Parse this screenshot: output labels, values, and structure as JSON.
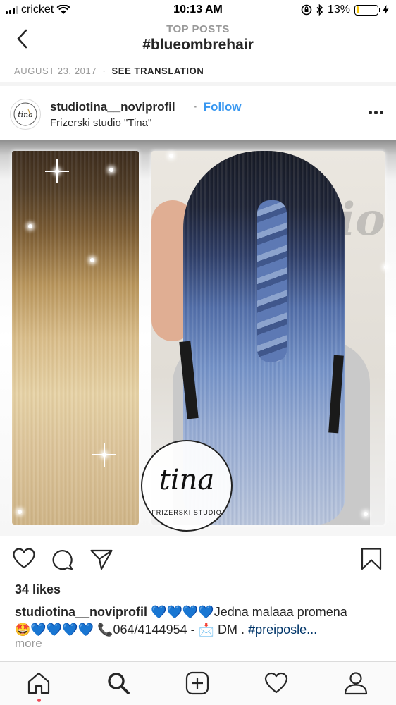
{
  "status_bar": {
    "carrier": "cricket",
    "time": "10:13 AM",
    "battery": "13%",
    "battery_level": 0.13
  },
  "header": {
    "subtitle": "TOP POSTS",
    "title": "#blueombrehair"
  },
  "post_meta": {
    "date": "AUGUST 23, 2017",
    "separator": "·",
    "translation_label": "SEE TRANSLATION"
  },
  "post": {
    "username": "studiotina__noviprofil",
    "follow_separator": "·",
    "follow_label": "Follow",
    "location": "Frizerski studio \"Tina\"",
    "image": {
      "logo_text": "tina",
      "logo_subtext": "FRIZERSKI STUDIO"
    },
    "likes": "34 likes",
    "caption": {
      "username": "studiotina__noviprofil",
      "hearts_1": "💙💙💙💙",
      "text_1": "Jedna malaaa promena",
      "emoji_face": "🤩",
      "hearts_2": "💙💙💙💙",
      "phone": "📞064/4144954 -",
      "dm": "📩 DM .",
      "hashtag": "#preiposle..."
    },
    "more_label": "more"
  },
  "colors": {
    "link_blue": "#3897f0",
    "text": "#262626",
    "muted": "#999999",
    "heart_blue": "#1d6ae5"
  },
  "icons": {
    "back": "chevron-left-icon",
    "like": "heart-icon",
    "comment": "comment-icon",
    "share": "send-icon",
    "save": "bookmark-icon",
    "tabs": [
      "home-icon",
      "search-icon",
      "add-post-icon",
      "activity-heart-icon",
      "profile-icon"
    ]
  }
}
